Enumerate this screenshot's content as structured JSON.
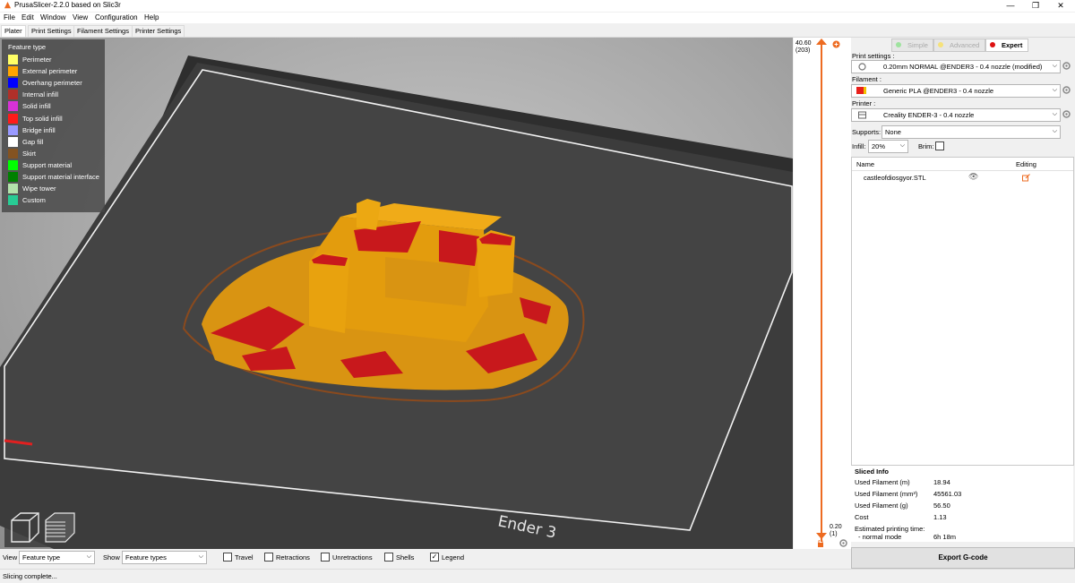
{
  "window": {
    "title": "PrusaSlicer-2.2.0 based on Slic3r",
    "controls": [
      "—",
      "❐",
      "✕"
    ]
  },
  "menu": [
    "File",
    "Edit",
    "Window",
    "View",
    "Configuration",
    "Help"
  ],
  "tabs": [
    "Plater",
    "Print Settings",
    "Filament Settings",
    "Printer Settings"
  ],
  "legend": {
    "title": "Feature type",
    "items": [
      {
        "label": "Perimeter",
        "color": "#ffff66"
      },
      {
        "label": "External perimeter",
        "color": "#ffa500"
      },
      {
        "label": "Overhang perimeter",
        "color": "#0000ff"
      },
      {
        "label": "Internal infill",
        "color": "#b03029"
      },
      {
        "label": "Solid infill",
        "color": "#d732d7"
      },
      {
        "label": "Top solid infill",
        "color": "#ff1a1a"
      },
      {
        "label": "Bridge infill",
        "color": "#9999ff"
      },
      {
        "label": "Gap fill",
        "color": "#ffffff"
      },
      {
        "label": "Skirt",
        "color": "#845321"
      },
      {
        "label": "Support material",
        "color": "#00ff00"
      },
      {
        "label": "Support material interface",
        "color": "#008000"
      },
      {
        "label": "Wipe tower",
        "color": "#b3e3ab"
      },
      {
        "label": "Custom",
        "color": "#28cc94"
      }
    ]
  },
  "bed_label": "Ender 3",
  "layer_slider": {
    "top_height": "40.60",
    "top_layer": "(203)",
    "bottom_height": "0.20",
    "bottom_layer": "(1)"
  },
  "modes": [
    "Simple",
    "Advanced",
    "Expert"
  ],
  "print_settings": {
    "label": "Print settings :",
    "value": "0.20mm NORMAL @ENDER3 - 0.4 nozzle (modified)"
  },
  "filament": {
    "label": "Filament :",
    "value": "Generic PLA @ENDER3 - 0.4 nozzle"
  },
  "printer": {
    "label": "Printer :",
    "value": "Creality ENDER-3 - 0.4 nozzle"
  },
  "supports": {
    "label": "Supports:",
    "value": "None"
  },
  "infill": {
    "label": "Infill:",
    "value": "20%"
  },
  "brim": {
    "label": "Brim:"
  },
  "objects": {
    "col_name": "Name",
    "col_editing": "Editing",
    "items": [
      {
        "name": "castleofdiosgyor.STL"
      }
    ]
  },
  "sliced_info": {
    "title": "Sliced Info",
    "rows": [
      {
        "label": "Used Filament (m)",
        "value": "18.94"
      },
      {
        "label": "Used Filament (mm³)",
        "value": "45561.03"
      },
      {
        "label": "Used Filament (g)",
        "value": "56.50"
      },
      {
        "label": "Cost",
        "value": "1.13"
      }
    ],
    "time_label": "Estimated printing time:",
    "time_mode": "- normal mode",
    "time_value": "6h 18m"
  },
  "export_label": "Export G-code",
  "bottom": {
    "view_label": "View",
    "view_value": "Feature type",
    "show_label": "Show",
    "show_value": "Feature types",
    "checkboxes": [
      {
        "label": "Travel",
        "checked": false
      },
      {
        "label": "Retractions",
        "checked": false
      },
      {
        "label": "Unretractions",
        "checked": false
      },
      {
        "label": "Shells",
        "checked": false
      },
      {
        "label": "Legend",
        "checked": true
      }
    ]
  },
  "status": "Slicing complete...",
  "colors": {
    "accent": "#ed6b21",
    "model_orange": "#e19a0c",
    "model_red": "#c4181c",
    "bed": "#3a3a3a"
  }
}
